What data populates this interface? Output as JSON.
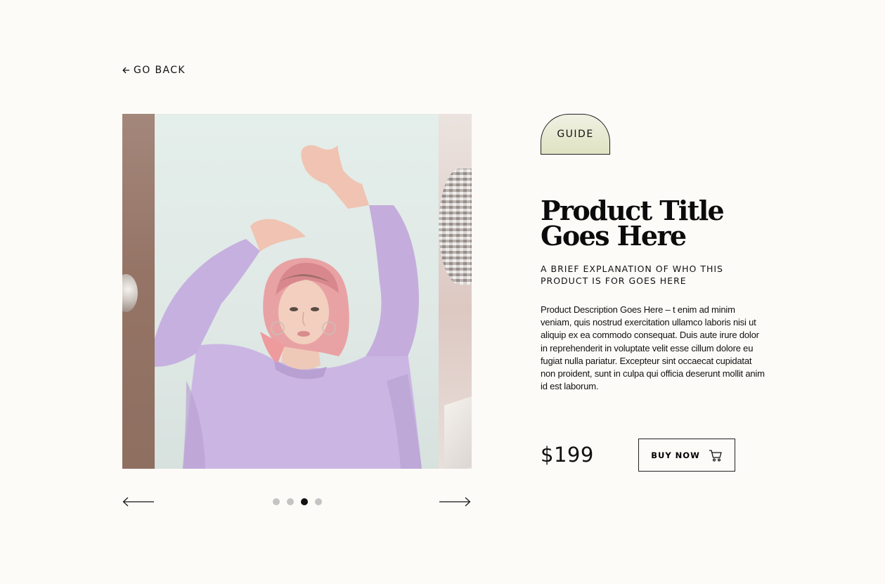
{
  "nav": {
    "back_label": "GO BACK"
  },
  "gallery": {
    "dot_count": 4,
    "active_index": 2
  },
  "product": {
    "badge": "GUIDE",
    "title_line1": "Product Title",
    "title_line2": "Goes Here",
    "subtitle": "A BRIEF EXPLANATION OF WHO THIS PRODUCT IS FOR GOES HERE",
    "description": "Product Description Goes Here  – t enim ad minim veniam, quis nostrud exercitation ullamco laboris nisi ut aliquip ex ea commodo consequat. Duis aute irure dolor in reprehenderit in voluptate velit esse cillum dolore eu fugiat nulla pariatur. Excepteur sint occaecat cupidatat non proident, sunt in culpa qui officia deserunt mollit anim id est laborum.",
    "price": "$199",
    "buy_label": "BUY NOW"
  },
  "icons": {
    "back": "arrow-left-icon",
    "prev": "long-arrow-left-icon",
    "next": "long-arrow-right-icon",
    "cart": "cart-icon"
  },
  "colors": {
    "background": "#fdfbf8",
    "badge_fill": "#e4e6c9",
    "dot_inactive": "#c4c4c2",
    "dot_active": "#111111",
    "sweatshirt": "#cbb6e3"
  }
}
